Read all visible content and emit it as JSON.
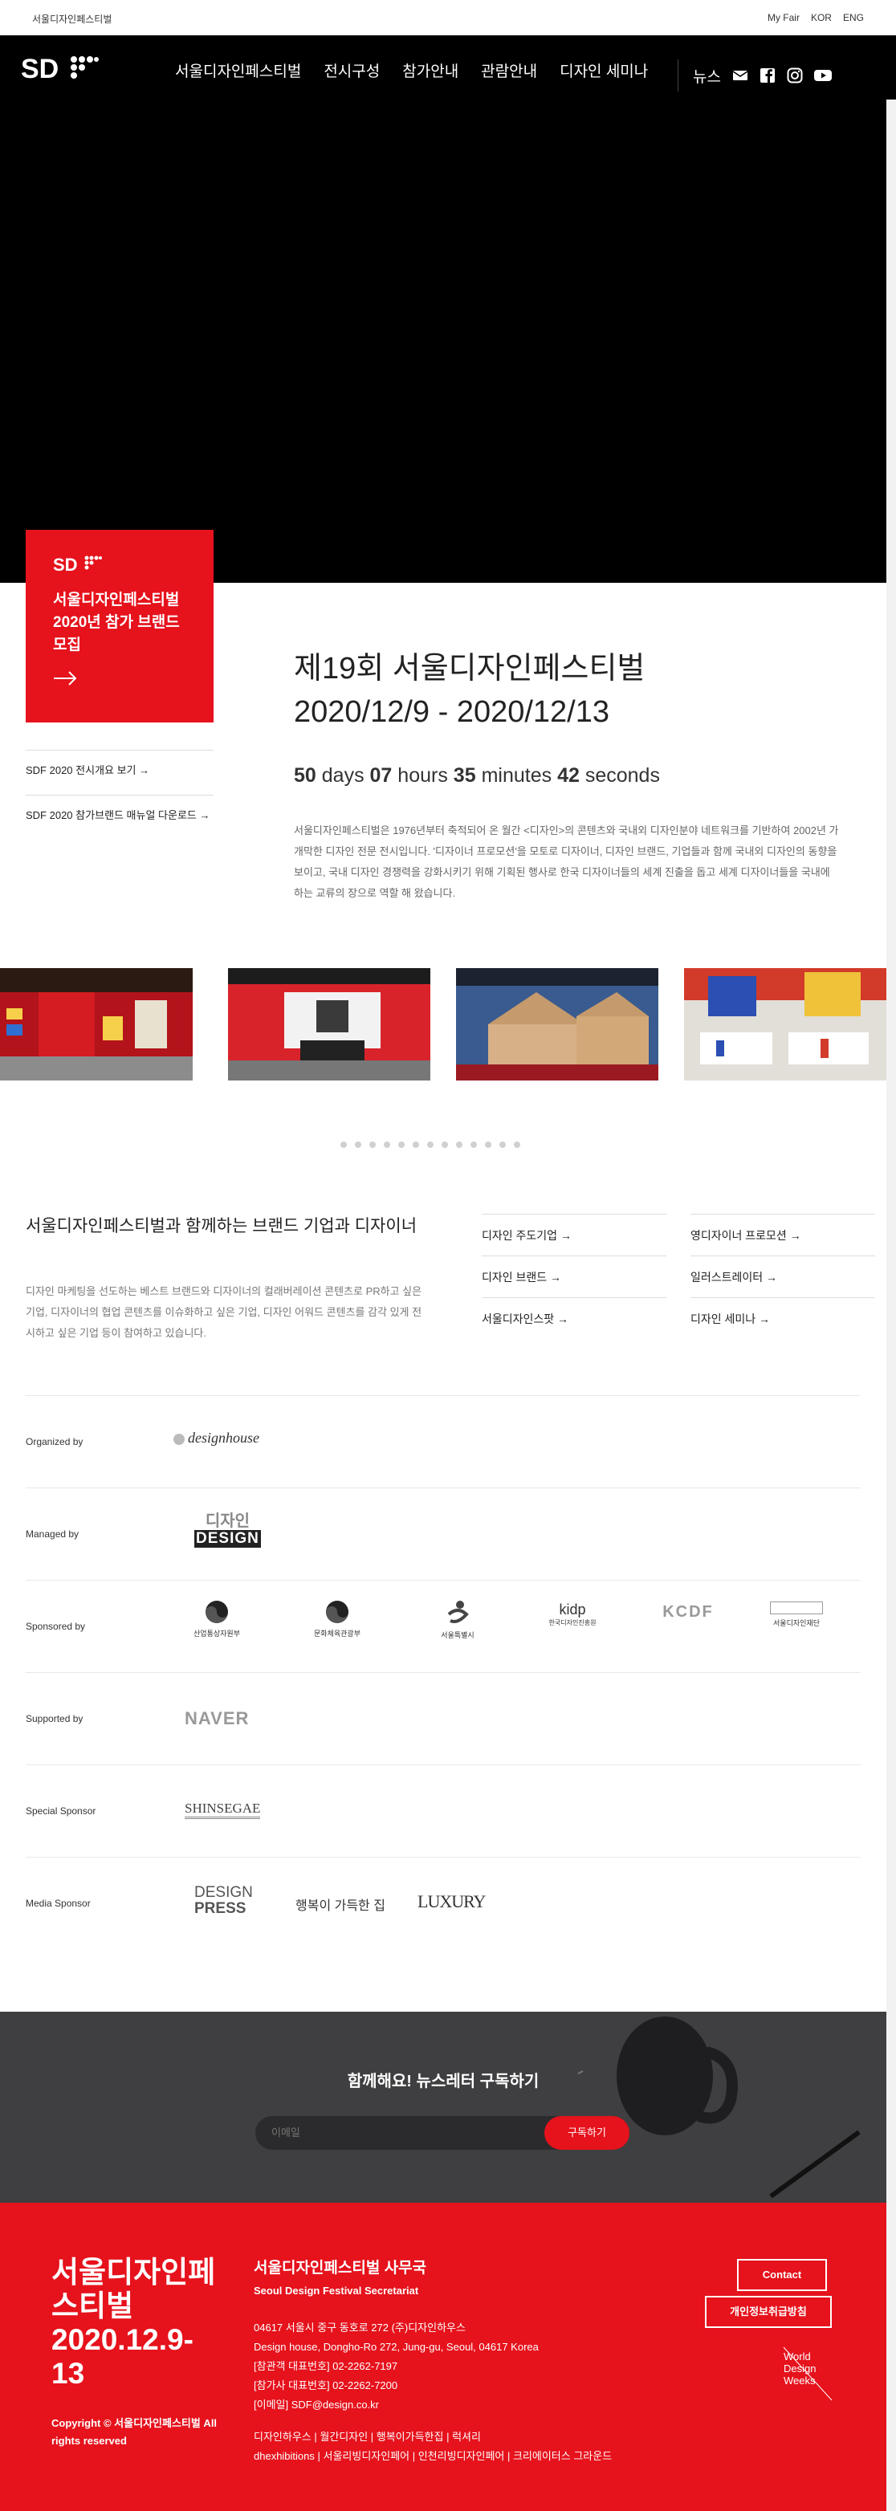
{
  "topbar": {
    "brand": "서울디자인페스티벌",
    "links": [
      "My Fair",
      "KOR",
      "ENG"
    ]
  },
  "nav": {
    "menu": [
      "서울디자인페스티벌",
      "전시구성",
      "참가안내",
      "관람안내",
      "디자인 세미나",
      "뉴스"
    ]
  },
  "promo": {
    "title": "서울디자인페스티벌 2020년 참가 브랜드 모집"
  },
  "sidelinks": [
    "SDF 2020 전시개요 보기",
    "SDF 2020 참가브랜드 매뉴얼 다운로드"
  ],
  "event": {
    "title_line1": "제19회 서울디자인페스티벌",
    "title_line2": "2020/12/9 - 2020/12/13",
    "countdown": {
      "days": "50",
      "days_label": "days",
      "hours": "07",
      "hours_label": "hours",
      "minutes": "35",
      "minutes_label": "minutes",
      "seconds": "42",
      "seconds_label": "seconds"
    },
    "desc": [
      "서울디자인페스티벌은 1976년부터 축적되어 온 월간 <디자인>의 콘텐츠와 국내외 디자인분야 네트워크를 기반하여 2002년 가",
      "개막한 디자인 전문 전시입니다. '디자이너 프로모션'을 모토로 디자이너, 디자인 브랜드, 기업들과 함께 국내외 디자인의 동향을",
      "보이고, 국내 디자인 경쟁력을 강화시키기 위해 기획된 행사로 한국 디자이너들의 세계 진출을 돕고 세계 디자이너들을 국내에",
      "하는 교류의 장으로 역할 해 왔습니다."
    ]
  },
  "gallery": {
    "dot_count": 13
  },
  "brands": {
    "title": "서울디자인페스티벌과 함께하는 브랜드 기업과 디자이너",
    "desc": "디자인 마케팅을 선도하는 베스트 브랜드와 디자이너의 컬래버레이션 콘텐츠로 PR하고 싶은 기업, 디자이너의 협업 콘텐츠를 이슈화하고 싶은 기업, 디자인 어워드 콘텐츠를 감각 있게 전시하고 싶은 기업 등이 참여하고 있습니다.",
    "links_col1": [
      "디자인 주도기업",
      "디자인 브랜드",
      "서울디자인스팟"
    ],
    "links_col2": [
      "영디자이너 프로모션",
      "일러스트레이터",
      "디자인 세미나"
    ]
  },
  "sponsors": {
    "organized": {
      "label": "Organized by",
      "logo": "designhouse"
    },
    "managed": {
      "label": "Managed by",
      "logo_top": "디자인",
      "logo_bottom": "DESIGN"
    },
    "sponsored": {
      "label": "Sponsored by",
      "logos": [
        "산업통상자원부",
        "문화체육관광부",
        "서울특별시",
        "kidp",
        "한국디자인진흥원",
        "KCDF",
        "서울디자인재단"
      ]
    },
    "supported": {
      "label": "Supported by",
      "logo": "NAVER"
    },
    "special": {
      "label": "Special Sponsor",
      "logo": "SHINSEGAE"
    },
    "media": {
      "label": "Media Sponsor",
      "logos": [
        "DESIGN",
        "PRESS",
        "행복이 가득한 집",
        "LUXURY"
      ]
    }
  },
  "newsletter": {
    "title": "함께해요! 뉴스레터 구독하기",
    "placeholder": "이메일",
    "button": "구독하기"
  },
  "footer": {
    "big_line1": "서울디자인페",
    "big_line2": "스티벌",
    "big_line3": "2020.12.9-",
    "big_line4": "13",
    "copyright": "Copyright © 서울디자인페스티벌 All rights reserved",
    "office": "서울디자인페스티벌 사무국",
    "office_en": "Seoul Design Festival Secretariat",
    "address": [
      "04617 서울시 중구 동호로 272 (주)디자인하우스",
      "Design house, Dongho-Ro 272, Jung-gu, Seoul, 04617 Korea",
      "[참관객 대표번호] 02-2262-7197",
      "[참가사 대표번호] 02-2262-7200",
      "[이메일] SDF@design.co.kr"
    ],
    "links": [
      "디자인하우스 | 월간디자인 | 행복이가득한집 | 럭셔리",
      "dhexhibitions | 서울리빙디자인페어 | 인천리빙디자인페어 | 크리에이터스 그라운드"
    ],
    "contact": "Contact",
    "privacy": "개인정보취급방침",
    "wdw": [
      "World",
      "Design",
      "Weeks"
    ]
  }
}
